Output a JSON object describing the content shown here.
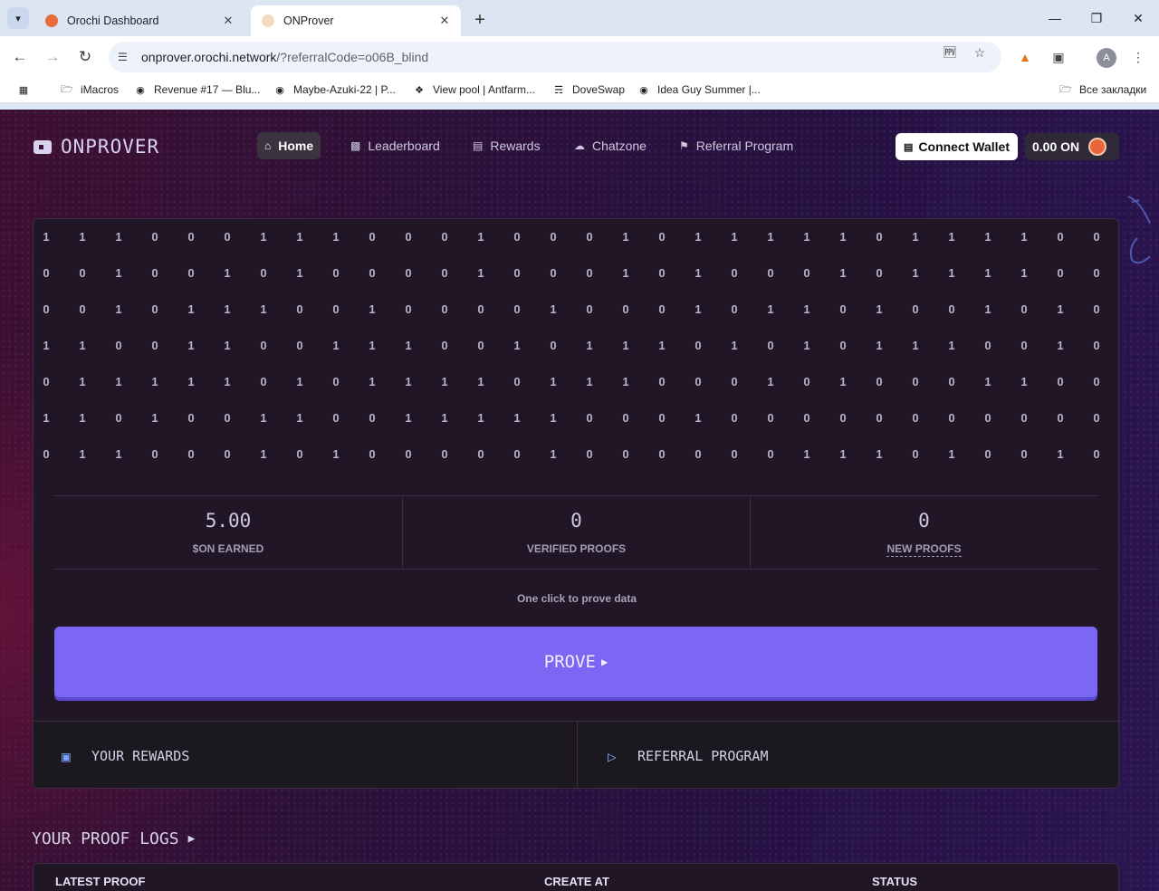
{
  "browser": {
    "tabs": [
      {
        "title": "Orochi Dashboard",
        "active": false
      },
      {
        "title": "ONProver",
        "active": true
      }
    ],
    "url_main": "onprover.orochi.network",
    "url_rest": "/?referralCode=o06B_blind",
    "profile_initial": "A",
    "bookmarks": [
      {
        "label": "iMacros",
        "icon": "folder-icon"
      },
      {
        "label": "Revenue #17 — Blu...",
        "icon": "site-icon"
      },
      {
        "label": "Maybe-Azuki-22 | P...",
        "icon": "site-icon"
      },
      {
        "label": "View pool | Antfarm...",
        "icon": "site-icon"
      },
      {
        "label": "DoveSwap",
        "icon": "site-icon"
      },
      {
        "label": "Idea Guy Summer |...",
        "icon": "site-icon"
      }
    ],
    "all_bookmarks": "Все закладки"
  },
  "header": {
    "logo": "ONPROVER",
    "nav": [
      {
        "label": "Home",
        "active": true,
        "icon": "home-icon"
      },
      {
        "label": "Leaderboard",
        "active": false,
        "icon": "leaderboard-icon"
      },
      {
        "label": "Rewards",
        "active": false,
        "icon": "rewards-icon"
      },
      {
        "label": "Chatzone",
        "active": false,
        "icon": "chat-icon"
      },
      {
        "label": "Referral Program",
        "active": false,
        "icon": "megaphone-icon"
      }
    ],
    "connect_label": "Connect Wallet",
    "balance": "0.00 ON"
  },
  "bit_matrix": [
    "11100011100010001011111011110011",
    "00100101000010001010001011110000",
    "00101110010000100010110100101011",
    "11001100111001011101010111001010",
    "01111101011110111000101000110011",
    "11010011001111100010000000000010",
    "01100010100000100000011101001010"
  ],
  "stats": [
    {
      "value": "5.00",
      "label": "$ON EARNED",
      "underline": false
    },
    {
      "value": "0",
      "label": "VERIFIED PROOFS",
      "underline": false
    },
    {
      "value": "0",
      "label": "NEW PROOFS",
      "underline": true
    }
  ],
  "hint": "One click to prove data",
  "prove_label": "PROVE",
  "bottom": {
    "rewards": "YOUR REWARDS",
    "referral": "REFERRAL PROGRAM"
  },
  "logs": {
    "title": "YOUR PROOF LOGS",
    "columns": [
      "LATEST PROOF",
      "CREATE AT",
      "STATUS"
    ]
  }
}
